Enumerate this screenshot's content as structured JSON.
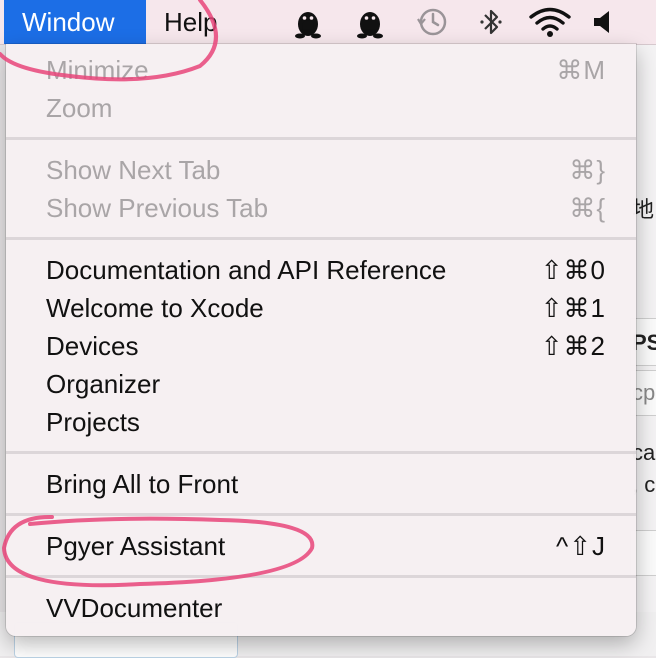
{
  "menubar": {
    "items": [
      "Window",
      "Help"
    ],
    "status_icons": [
      "qq-penguin-icon",
      "qq-penguin-icon",
      "time-machine-icon",
      "bluetooth-icon",
      "wifi-icon",
      "volume-icon"
    ]
  },
  "menu": {
    "items": [
      {
        "label": "Minimize",
        "shortcut": "⌘M",
        "enabled": false
      },
      {
        "label": "Zoom",
        "shortcut": "",
        "enabled": false
      },
      {
        "label": "Show Next Tab",
        "shortcut": "⌘}",
        "enabled": false
      },
      {
        "label": "Show Previous Tab",
        "shortcut": "⌘{",
        "enabled": false
      },
      {
        "label": "Documentation and API Reference",
        "shortcut": "⇧⌘0",
        "enabled": true
      },
      {
        "label": "Welcome to Xcode",
        "shortcut": "⇧⌘1",
        "enabled": true
      },
      {
        "label": "Devices",
        "shortcut": "⇧⌘2",
        "enabled": true
      },
      {
        "label": "Organizer",
        "shortcut": "",
        "enabled": true
      },
      {
        "label": "Projects",
        "shortcut": "",
        "enabled": true
      },
      {
        "label": "Bring All to Front",
        "shortcut": "",
        "enabled": true
      },
      {
        "label": "Pgyer Assistant",
        "shortcut": "^⇧J",
        "enabled": true
      },
      {
        "label": "VVDocumenter",
        "shortcut": "",
        "enabled": true
      }
    ]
  },
  "background": {
    "fragments": [
      "地",
      "PS",
      "cp",
      "ca",
      ", c"
    ]
  },
  "colors": {
    "menu_highlight": "#1c6ee6",
    "annotation": "#e8457a"
  }
}
